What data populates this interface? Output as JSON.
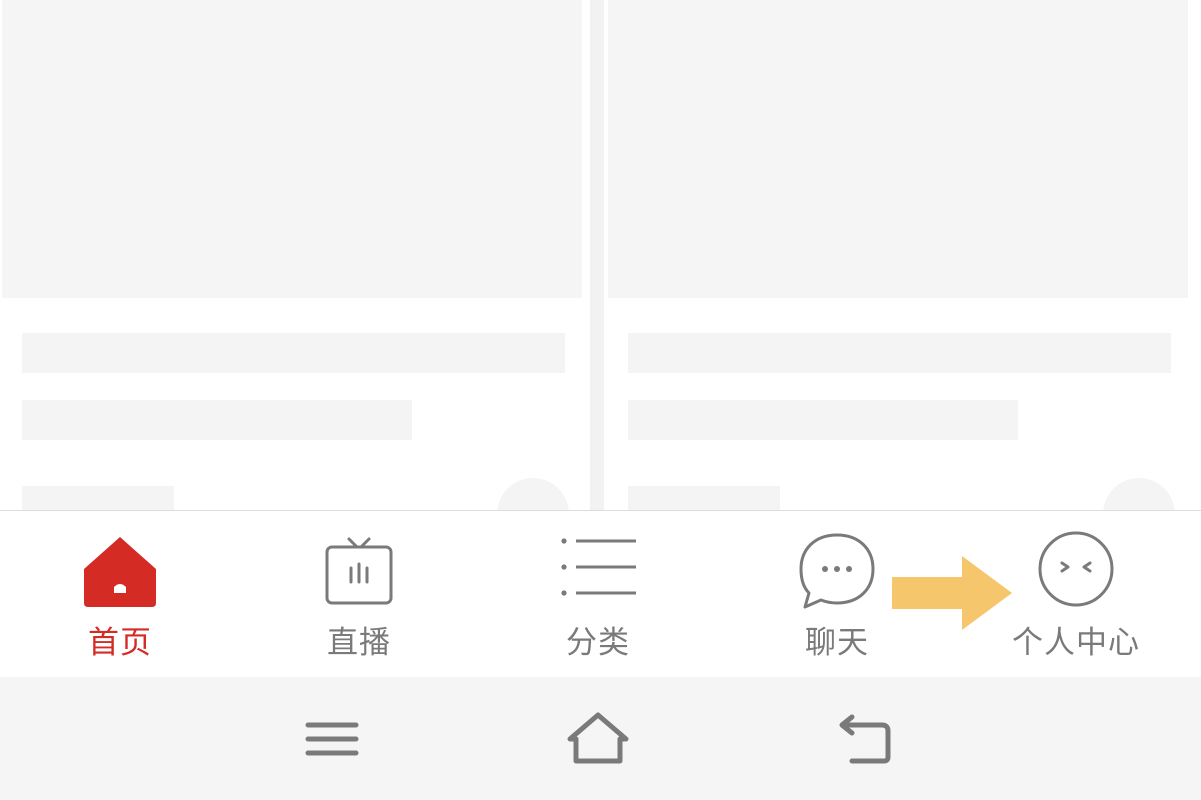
{
  "tabbar": {
    "accent_color": "#d52b25",
    "inactive_color": "#7a7a7a",
    "items": [
      {
        "label": "首页",
        "icon": "home-icon",
        "active": true
      },
      {
        "label": "直播",
        "icon": "tv-live-icon",
        "active": false
      },
      {
        "label": "分类",
        "icon": "category-list-icon",
        "active": false
      },
      {
        "label": "聊天",
        "icon": "chat-bubble-icon",
        "active": false
      },
      {
        "label": "个人中心",
        "icon": "profile-face-icon",
        "active": false
      }
    ]
  },
  "annotation": {
    "icon": "arrow-right-icon",
    "color": "#f5c66b"
  },
  "system_nav": {
    "buttons": [
      {
        "icon": "menu-icon"
      },
      {
        "icon": "home-outline-icon"
      },
      {
        "icon": "back-icon"
      }
    ]
  }
}
